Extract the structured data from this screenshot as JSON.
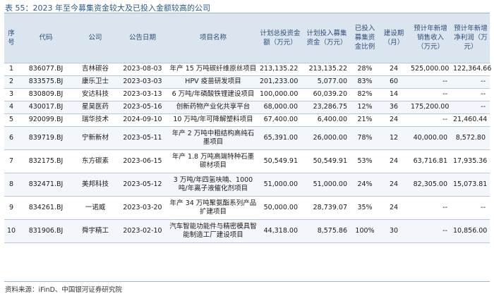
{
  "caption": "表 55：2023 年至今募集资金较大及已投入金额较高的公司",
  "headers": [
    "序号",
    "代码",
    "公司",
    "公告日期",
    "项目名称",
    "计划总投资金额（万元）",
    "计划投入募集资金（万元）",
    "已投入募集资金比例",
    "建设期（月）",
    "预计年新增销售收入（万元）",
    "预计年新增净利润（万元）"
  ],
  "rows": [
    [
      "1",
      "836077.BJ",
      "吉林碳谷",
      "2023-08-03",
      "年产 15 万吨碳纤维原丝项目",
      "213,135.22",
      "213,135.22",
      "28%",
      "24",
      "525,000.00",
      "122,364.66"
    ],
    [
      "2",
      "833575.BJ",
      "康乐卫士",
      "2023-03-03",
      "HPV 疫苗研发项目",
      "201,233.00",
      "5,077.00",
      "83%",
      "60",
      "--",
      "--"
    ],
    [
      "3",
      "830809.BJ",
      "安达科技",
      "2023-03-13",
      "6 万吨/年磷酸铁锂建设项目",
      "100,000.00",
      "60,039.20",
      "82%",
      "14",
      "--",
      "--"
    ],
    [
      "4",
      "430017.BJ",
      "星昊医药",
      "2023-05-16",
      "创新药物产业化共享平台",
      "68,000.00",
      "23,286.75",
      "12%",
      "36",
      "175,200.00",
      "--"
    ],
    [
      "5",
      "920099.BJ",
      "瑞华技术",
      "2024-09-10",
      "10 万吨/年可降解塑料项目",
      "67,400.00",
      "6,400.00",
      "21%",
      "24",
      "--",
      "21,460.44"
    ],
    [
      "6",
      "839719.BJ",
      "宁新新材",
      "2023-05-11",
      "年产 2 万吨中粗结构高纯石墨项目",
      "65,391.00",
      "26,000.00",
      "78%",
      "12",
      "40,000.00",
      "8,572.80"
    ],
    [
      "7",
      "832175.BJ",
      "东方碳素",
      "2023-06-15",
      "年产 1.8 万吨高端特种石墨碳材项目",
      "50,549.91",
      "50,549.91",
      "53%",
      "24",
      "63,716.81",
      "17,935.36"
    ],
    [
      "8",
      "832471.BJ",
      "美邦科技",
      "2023-05-12",
      "3 万吨/年四氢呋喃、1000 吨/年离子液催化剂项目",
      "51,000.00",
      "51,000.00",
      "24%",
      "24",
      "82,305.00",
      "15,073.81"
    ],
    [
      "9",
      "834261.BJ",
      "一诺威",
      "2023-03-20",
      "年产 34 万吨聚氨酯系列产品扩建项目",
      "50,000.00",
      "28,739.07",
      "35%",
      "24",
      "--",
      "--"
    ],
    [
      "10",
      "831906.BJ",
      "舜宇精工",
      "2023-02-10",
      "汽车智能功能件与精密模具智能制造工厂建设项目",
      "44,318.00",
      "8,575.86",
      "100%",
      "30",
      "--",
      "10,856.00"
    ]
  ],
  "source": "资料来源：iFinD、中国银河证券研究院"
}
